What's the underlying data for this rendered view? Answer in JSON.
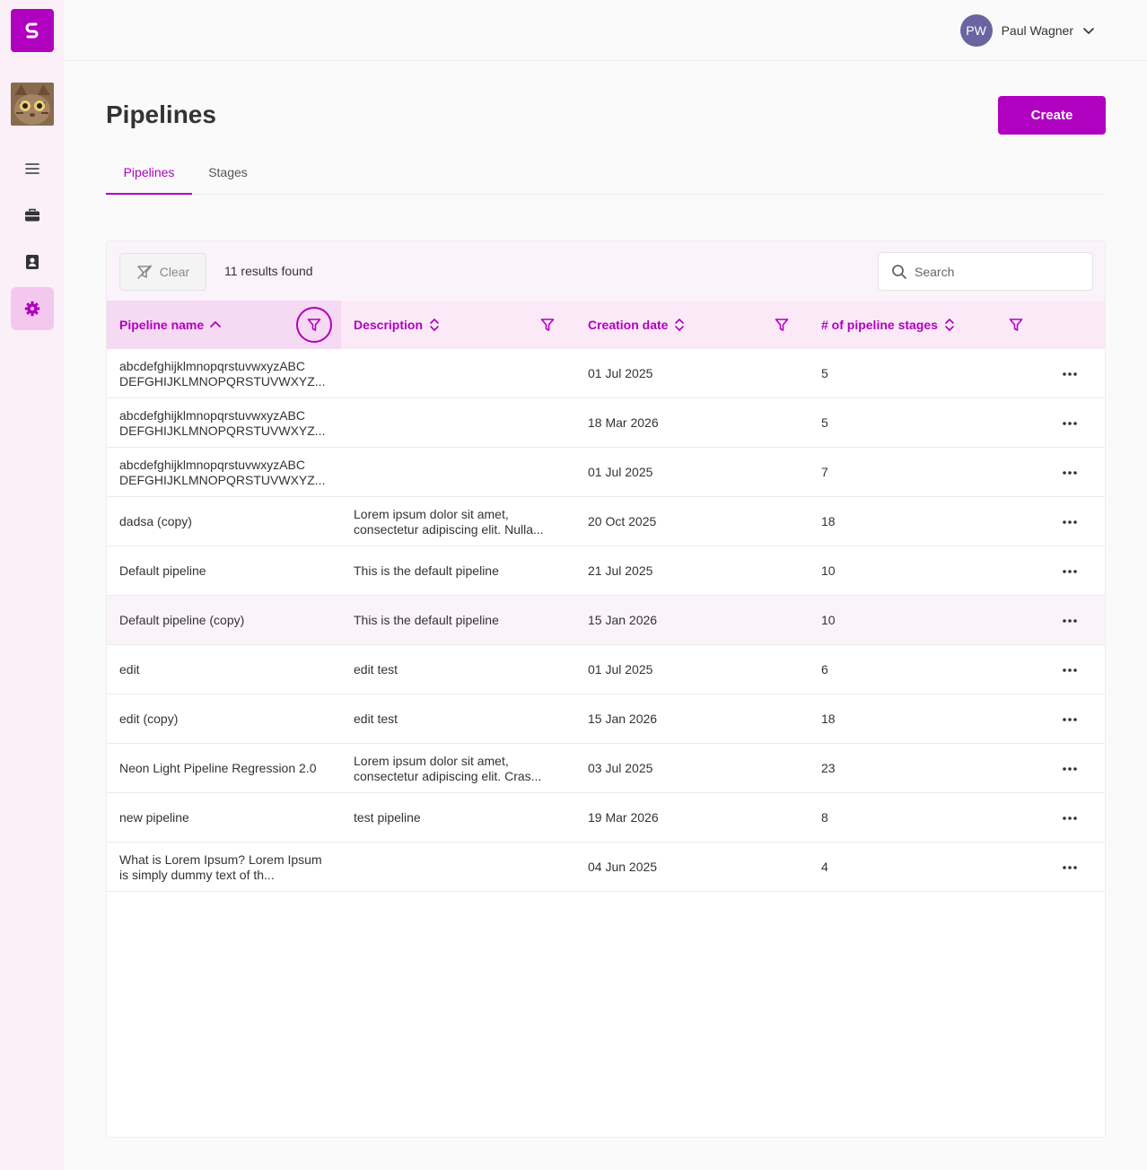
{
  "header": {
    "user_initials": "PW",
    "user_name": "Paul Wagner"
  },
  "page": {
    "title": "Pipelines",
    "create_label": "Create"
  },
  "tabs": [
    {
      "label": "Pipelines",
      "active": true
    },
    {
      "label": "Stages",
      "active": false
    }
  ],
  "toolbar": {
    "clear_label": "Clear",
    "results_text": "11 results found",
    "search_placeholder": "Search"
  },
  "table": {
    "columns": [
      "Pipeline name",
      "Description",
      "Creation date",
      "# of pipeline stages"
    ],
    "rows": [
      {
        "name": "abcdefghijklmnopqrstuvwxyzABC DEFGHIJKLMNOPQRSTUVWXYZ...",
        "description": "",
        "date": "01 Jul 2025",
        "stages": "5"
      },
      {
        "name": "abcdefghijklmnopqrstuvwxyzABC DEFGHIJKLMNOPQRSTUVWXYZ...",
        "description": "",
        "date": "18 Mar 2026",
        "stages": "5"
      },
      {
        "name": "abcdefghijklmnopqrstuvwxyzABC DEFGHIJKLMNOPQRSTUVWXYZ...",
        "description": "",
        "date": "01 Jul 2025",
        "stages": "7"
      },
      {
        "name": "dadsa (copy)",
        "description": "Lorem ipsum dolor sit amet, consectetur adipiscing elit. Nulla...",
        "date": "20 Oct 2025",
        "stages": "18"
      },
      {
        "name": "Default pipeline",
        "description": "This is the default pipeline",
        "date": "21 Jul 2025",
        "stages": "10"
      },
      {
        "name": "Default pipeline (copy)",
        "description": "This is the default pipeline",
        "date": "15 Jan 2026",
        "stages": "10"
      },
      {
        "name": "edit",
        "description": "edit test",
        "date": "01 Jul 2025",
        "stages": "6"
      },
      {
        "name": "edit (copy)",
        "description": "edit test",
        "date": "15 Jan 2026",
        "stages": "18"
      },
      {
        "name": "Neon Light Pipeline Regression 2.0",
        "description": "Lorem ipsum dolor sit amet, consectetur adipiscing elit. Cras...",
        "date": "03 Jul 2025",
        "stages": "23"
      },
      {
        "name": "new pipeline",
        "description": "test pipeline",
        "date": "19 Mar 2026",
        "stages": "8"
      },
      {
        "name": "What is Lorem Ipsum? Lorem Ipsum is simply dummy text of th...",
        "description": "",
        "date": "04 Jun 2025",
        "stages": "4"
      }
    ]
  },
  "icons": {
    "logo": "logo-icon",
    "menu": "menu-icon",
    "briefcase": "briefcase-icon",
    "contacts": "contact-book-icon",
    "settings": "gear-icon",
    "filter": "filter-icon",
    "sort": "sort-icon",
    "more": "more-horizontal-icon"
  },
  "colors": {
    "accent": "#b000c0",
    "sidebar_bg": "#fbf0f8",
    "header_row_bg": "#fbe9f8",
    "avatar_bg": "#6a64a0"
  }
}
